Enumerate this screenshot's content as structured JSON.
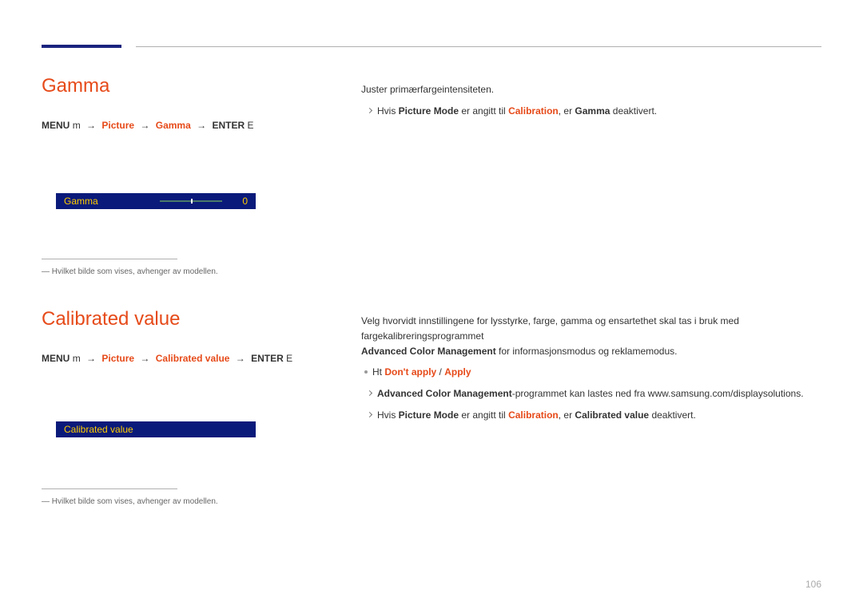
{
  "gamma": {
    "heading": "Gamma",
    "path": {
      "menu": "MENU",
      "menu_icon": "m",
      "p1": "Picture",
      "p2": "Gamma",
      "enter": "ENTER",
      "enter_icon": "E"
    },
    "ui": {
      "label": "Gamma",
      "value": "0"
    },
    "footnote": "Hvilket bilde som vises, avhenger av modellen.",
    "body": {
      "line1": "Juster primærfargeintensiteten.",
      "note_prefix": "Hvis ",
      "note_pm": "Picture Mode",
      "note_mid": " er angitt til ",
      "note_cal": "Calibration",
      "note_mid2": ", er ",
      "note_gamma": "Gamma",
      "note_suffix": " deaktivert."
    }
  },
  "calibrated": {
    "heading": "Calibrated value",
    "path": {
      "menu": "MENU",
      "menu_icon": "m",
      "p1": "Picture",
      "p2": "Calibrated value",
      "enter": "ENTER",
      "enter_icon": "E"
    },
    "ui": {
      "label": "Calibrated value"
    },
    "footnote": "Hvilket bilde som vises, avhenger av modellen.",
    "body": {
      "line1": "Velg hvorvidt innstillingene for lysstyrke, farge, gamma og ensartethet skal tas i bruk med fargekalibreringsprogrammet",
      "line2_bold": "Advanced Color Management",
      "line2_rest": " for informasjonsmodus og reklamemodus.",
      "options_dot_prefix": "Ht",
      "option1": "Don't apply",
      "option_sep": " / ",
      "option2": "Apply",
      "note1_bold": "Advanced Color Management",
      "note1_rest": "-programmet kan lastes ned fra www.samsung.com/displaysolutions.",
      "note2_prefix": "Hvis ",
      "note2_pm": "Picture Mode",
      "note2_mid": " er angitt til ",
      "note2_cal": "Calibration",
      "note2_mid2": ", er ",
      "note2_cv": "Calibrated value",
      "note2_suffix": " deaktivert."
    }
  },
  "page_number": "106"
}
